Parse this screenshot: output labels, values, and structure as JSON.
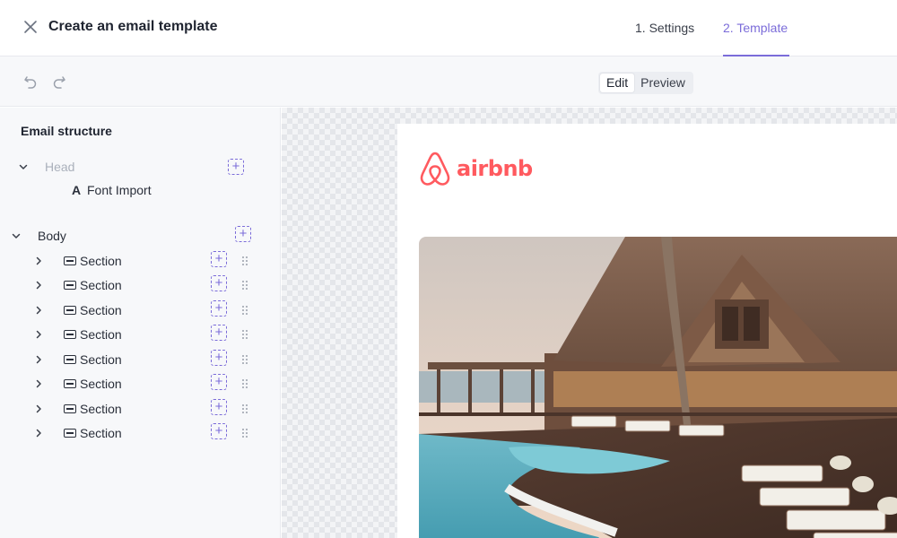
{
  "header": {
    "title": "Create an email template",
    "steps": [
      "1. Settings",
      "2. Template"
    ],
    "active_step": 1
  },
  "toolbar": {
    "modes": [
      "Edit",
      "Preview"
    ],
    "active_mode": "Edit"
  },
  "sidebar": {
    "title": "Email structure",
    "head": {
      "label": "Head",
      "children": [
        "Font Import"
      ]
    },
    "body": {
      "label": "Body",
      "sections": [
        "Section",
        "Section",
        "Section",
        "Section",
        "Section",
        "Section",
        "Section",
        "Section"
      ]
    }
  },
  "email": {
    "logo_text": "airbnb",
    "brand_color": "#ff5a5f",
    "hero_icon": "resort-pool-photo"
  },
  "colors": {
    "accent": "#7b6cd9"
  }
}
